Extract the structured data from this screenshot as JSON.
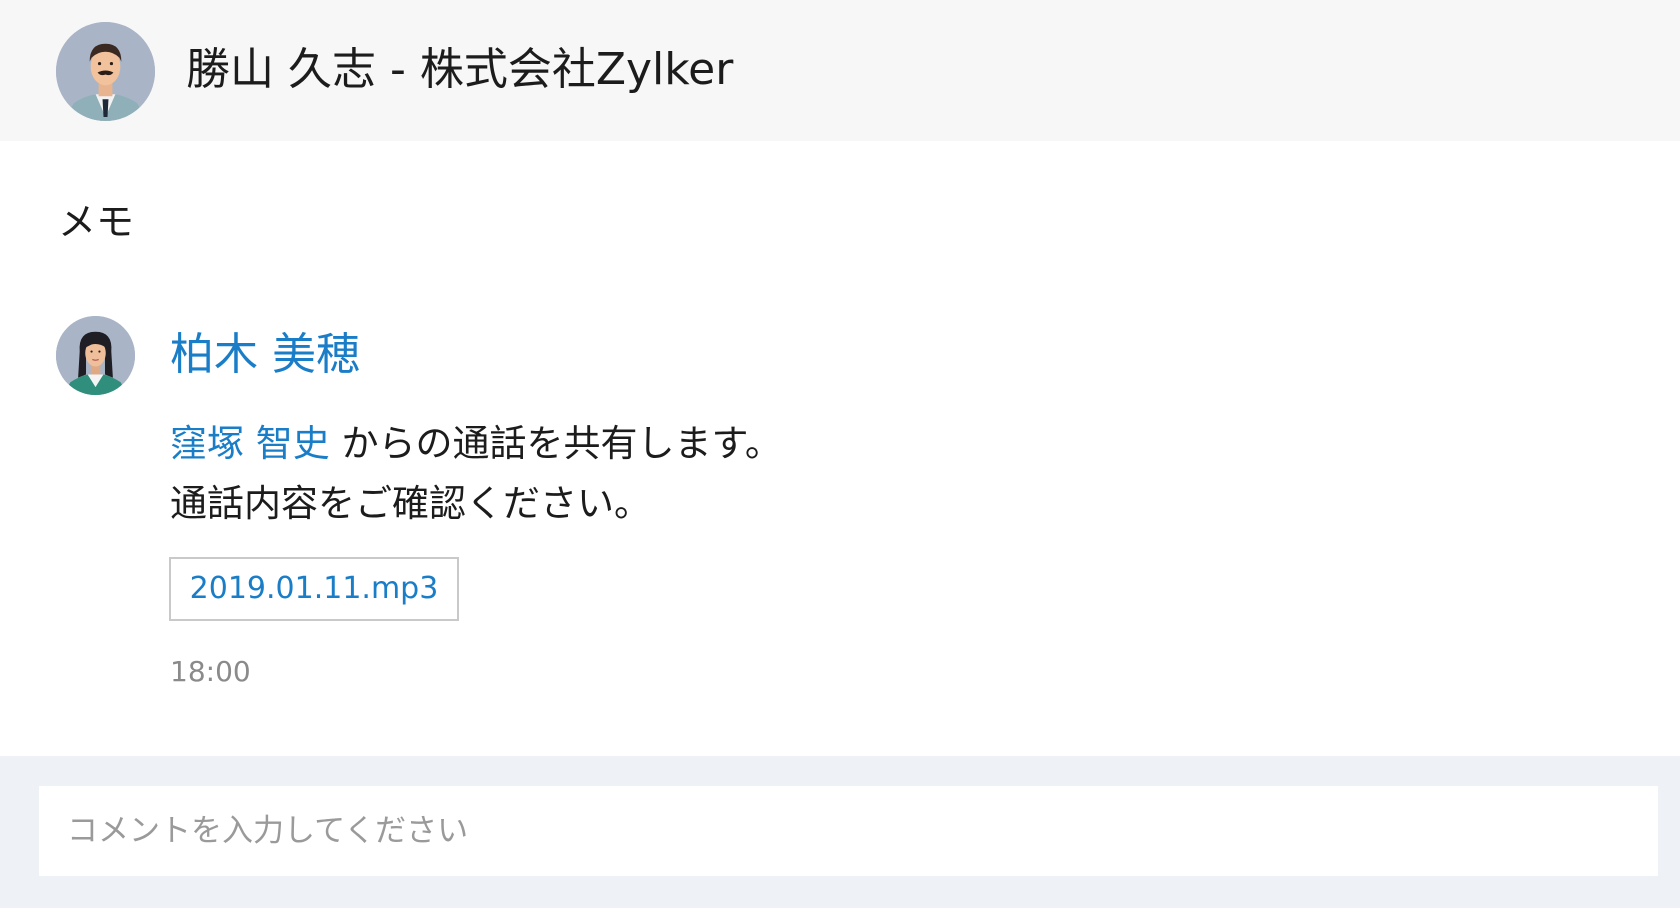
{
  "header": {
    "title": "勝山 久志 - 株式会社Zylker"
  },
  "section": {
    "label": "メモ"
  },
  "message": {
    "author": "柏木 美穂",
    "mention": "窪塚 智史",
    "line1_rest": " からの通話を共有します。",
    "line2": "通話内容をご確認ください。",
    "attachment": "2019.01.11.mp3",
    "time": "18:00"
  },
  "comment": {
    "placeholder": "コメントを入力してください"
  },
  "colors": {
    "link": "#1a7dc7",
    "header_bg": "#f7f7f8",
    "comment_bg": "#eef1f5"
  }
}
